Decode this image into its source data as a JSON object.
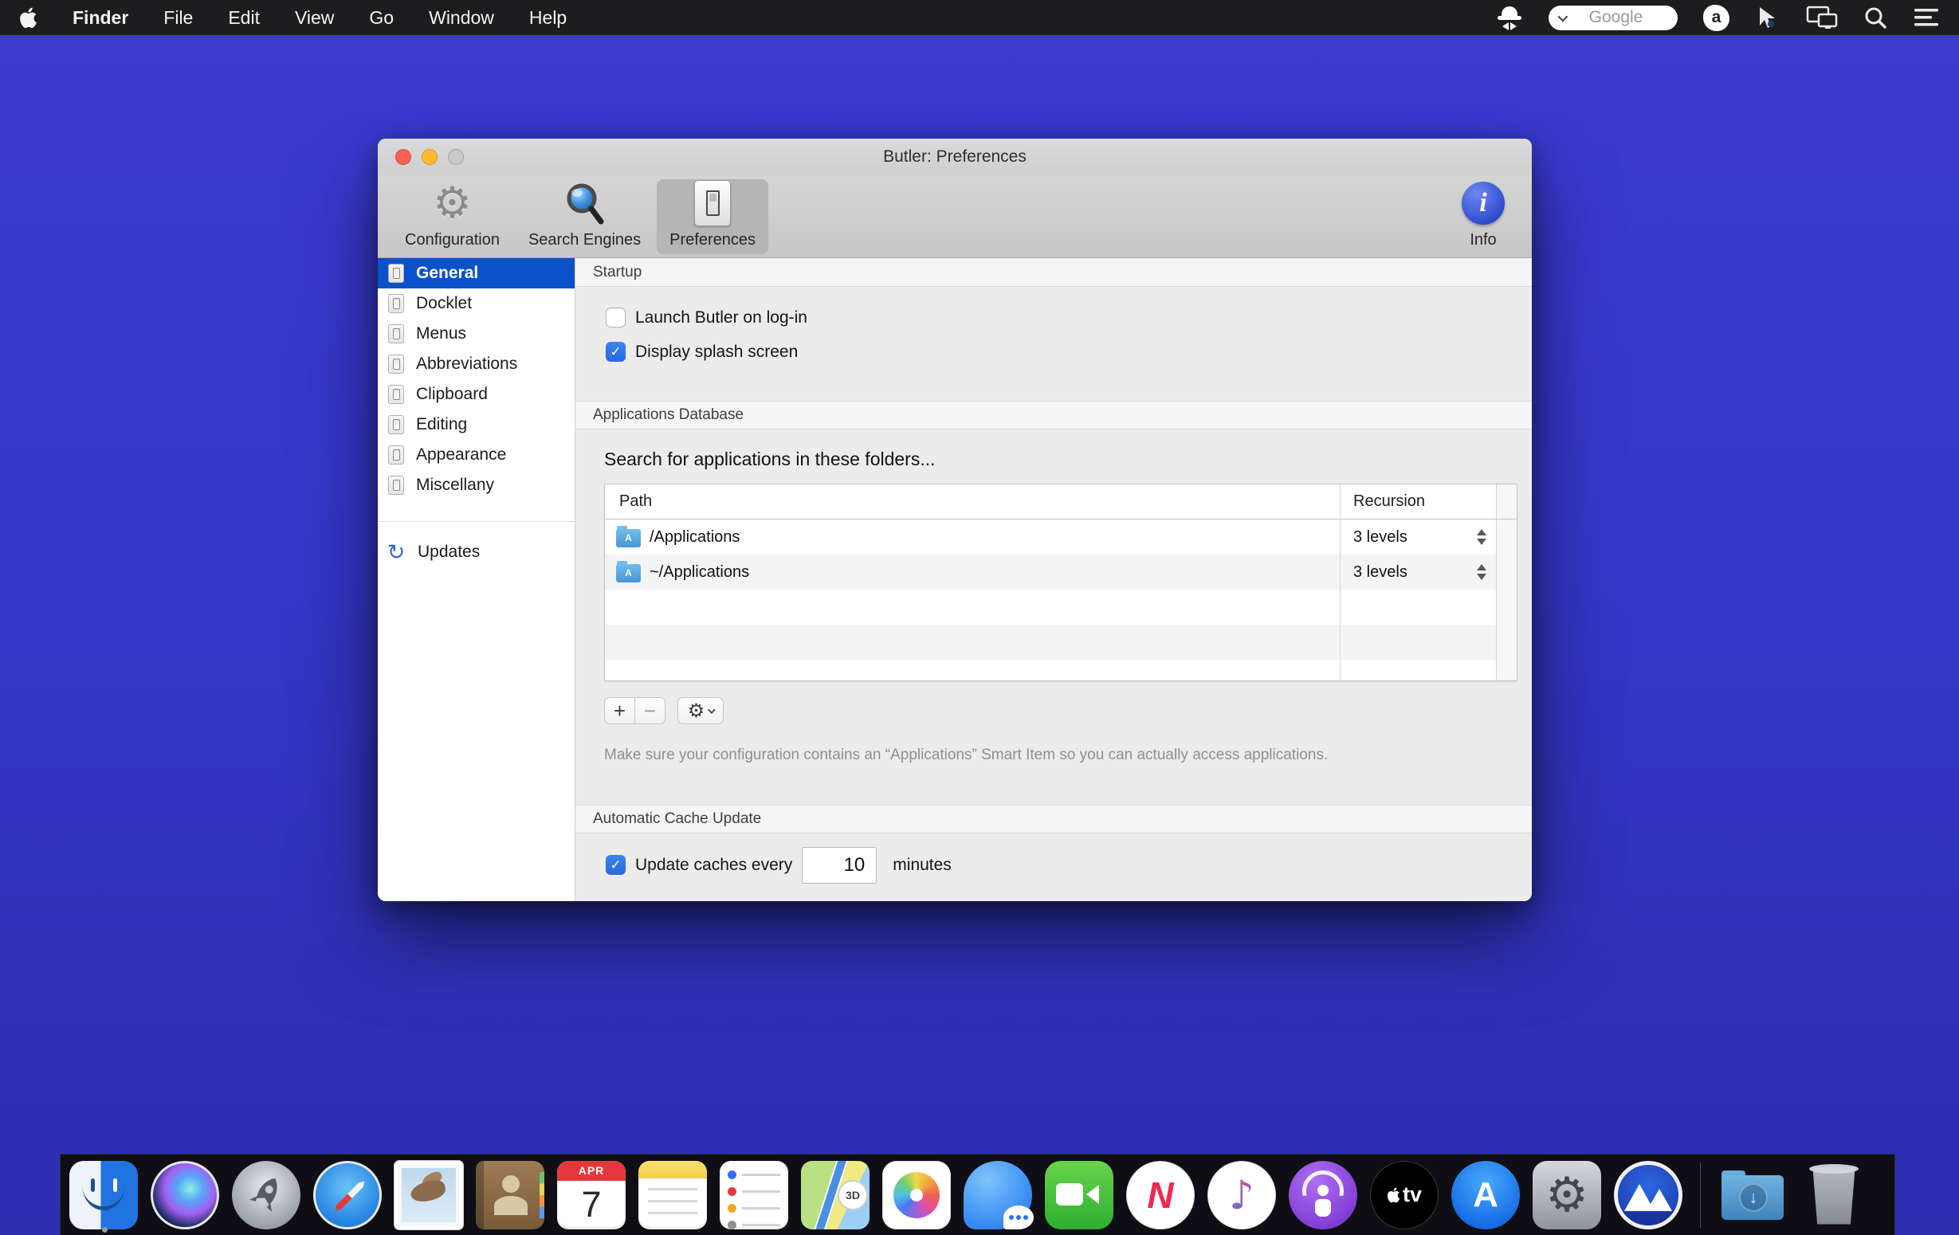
{
  "menu_bar": {
    "items": [
      "Finder",
      "File",
      "Edit",
      "View",
      "Go",
      "Window",
      "Help"
    ],
    "search_placeholder": "Google",
    "avast_letter": "a",
    "status_icons": [
      "butler-hat",
      "search-field",
      "avast",
      "cursor-arrow",
      "display-mirroring",
      "spotlight",
      "menu-list"
    ]
  },
  "window": {
    "title": "Butler: Preferences",
    "toolbar": {
      "items": [
        {
          "label": "Configuration"
        },
        {
          "label": "Search Engines"
        },
        {
          "label": "Preferences",
          "selected": true
        }
      ],
      "info_label": "Info",
      "info_glyph": "i"
    },
    "sidebar": {
      "items": [
        "General",
        "Docklet",
        "Menus",
        "Abbreviations",
        "Clipboard",
        "Editing",
        "Appearance",
        "Miscellany"
      ],
      "selected_index": 0,
      "updates_label": "Updates",
      "updates_glyph": "↻"
    },
    "sections": {
      "startup": {
        "title": "Startup",
        "checkboxes": [
          {
            "label": "Launch Butler on log-in",
            "checked": false
          },
          {
            "label": "Display splash screen",
            "checked": true
          }
        ]
      },
      "apps_db": {
        "title": "Applications Database",
        "prompt": "Search for applications in these folders...",
        "table": {
          "columns": [
            "Path",
            "Recursion"
          ],
          "rows": [
            {
              "path": "/Applications",
              "recursion": "3 levels"
            },
            {
              "path": "~/Applications",
              "recursion": "3 levels"
            }
          ],
          "folder_letter": "A"
        },
        "buttons": {
          "add": "+",
          "remove": "−",
          "gear": "⚙"
        },
        "note": "Make sure your configuration contains an “Applications” Smart Item so you can actually access applications."
      },
      "cache": {
        "title": "Automatic Cache Update",
        "checkbox_label": "Update caches every",
        "minutes_value": "10",
        "suffix": "minutes",
        "checked": true
      }
    },
    "glyphs": {
      "check": "✓",
      "toolbar_gear": "⚙"
    }
  },
  "dock": {
    "apps": [
      "finder",
      "siri",
      "launchpad",
      "safari",
      "mail",
      "contacts",
      "calendar",
      "notes",
      "reminders",
      "maps",
      "photos",
      "messages",
      "facetime",
      "news",
      "music",
      "podcasts",
      "apple-tv",
      "app-store",
      "system-preferences",
      "mountain-app",
      "downloads-folder",
      "trash"
    ],
    "calendar": {
      "month": "APR",
      "day": "7"
    },
    "appletv_label": "tv",
    "appstore_letter": "A",
    "news_letter": "N",
    "music_note": "♪",
    "sysprefs_gear": "⚙",
    "maps_badge": "3D",
    "downloads_arrow": "↓"
  },
  "colors": {
    "desktop_blue": "#3138c9",
    "menubar_bg": "#1d1d1f",
    "selection_blue": "#0b51c9",
    "checkbox_blue": "#2e7de9",
    "window_bg": "#ececec"
  }
}
